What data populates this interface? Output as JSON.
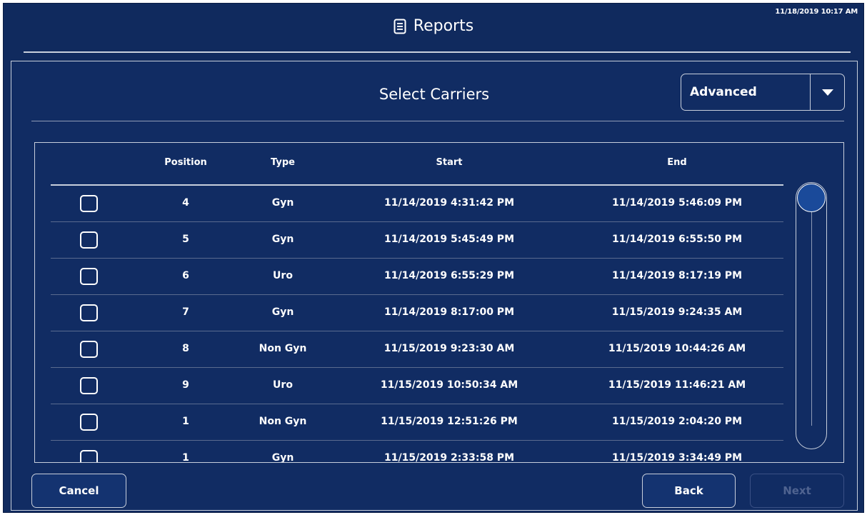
{
  "header": {
    "title": "Reports",
    "title_icon": "document-icon",
    "datetime": "11/18/2019 10:17 AM"
  },
  "panel": {
    "title": "Select Carriers",
    "mode_select": {
      "value": "Advanced",
      "icon": "chevron-down-icon"
    }
  },
  "table": {
    "columns": [
      "Position",
      "Type",
      "Start",
      "End"
    ],
    "rows": [
      {
        "checked": false,
        "position": "4",
        "type": "Gyn",
        "start": "11/14/2019 4:31:42 PM",
        "end": "11/14/2019 5:46:09 PM"
      },
      {
        "checked": false,
        "position": "5",
        "type": "Gyn",
        "start": "11/14/2019 5:45:49 PM",
        "end": "11/14/2019 6:55:50 PM"
      },
      {
        "checked": false,
        "position": "6",
        "type": "Uro",
        "start": "11/14/2019 6:55:29 PM",
        "end": "11/14/2019 8:17:19 PM"
      },
      {
        "checked": false,
        "position": "7",
        "type": "Gyn",
        "start": "11/14/2019 8:17:00 PM",
        "end": "11/15/2019 9:24:35 AM"
      },
      {
        "checked": false,
        "position": "8",
        "type": "Non Gyn",
        "start": "11/15/2019 9:23:30 AM",
        "end": "11/15/2019 10:44:26 AM"
      },
      {
        "checked": false,
        "position": "9",
        "type": "Uro",
        "start": "11/15/2019 10:50:34 AM",
        "end": "11/15/2019 11:46:21 AM"
      },
      {
        "checked": false,
        "position": "1",
        "type": "Non Gyn",
        "start": "11/15/2019 12:51:26 PM",
        "end": "11/15/2019 2:04:20 PM"
      },
      {
        "checked": false,
        "position": "1",
        "type": "Gyn",
        "start": "11/15/2019 2:33:58 PM",
        "end": "11/15/2019 3:34:49 PM"
      }
    ]
  },
  "footer": {
    "cancel_label": "Cancel",
    "back_label": "Back",
    "next_label": "Next",
    "next_enabled": false
  },
  "colors": {
    "background": "#102a5e",
    "panel": "#112c63",
    "border": "#c8cfdc",
    "disabled_text": "#4f6390",
    "scroll_thumb": "#1a4a9a"
  }
}
